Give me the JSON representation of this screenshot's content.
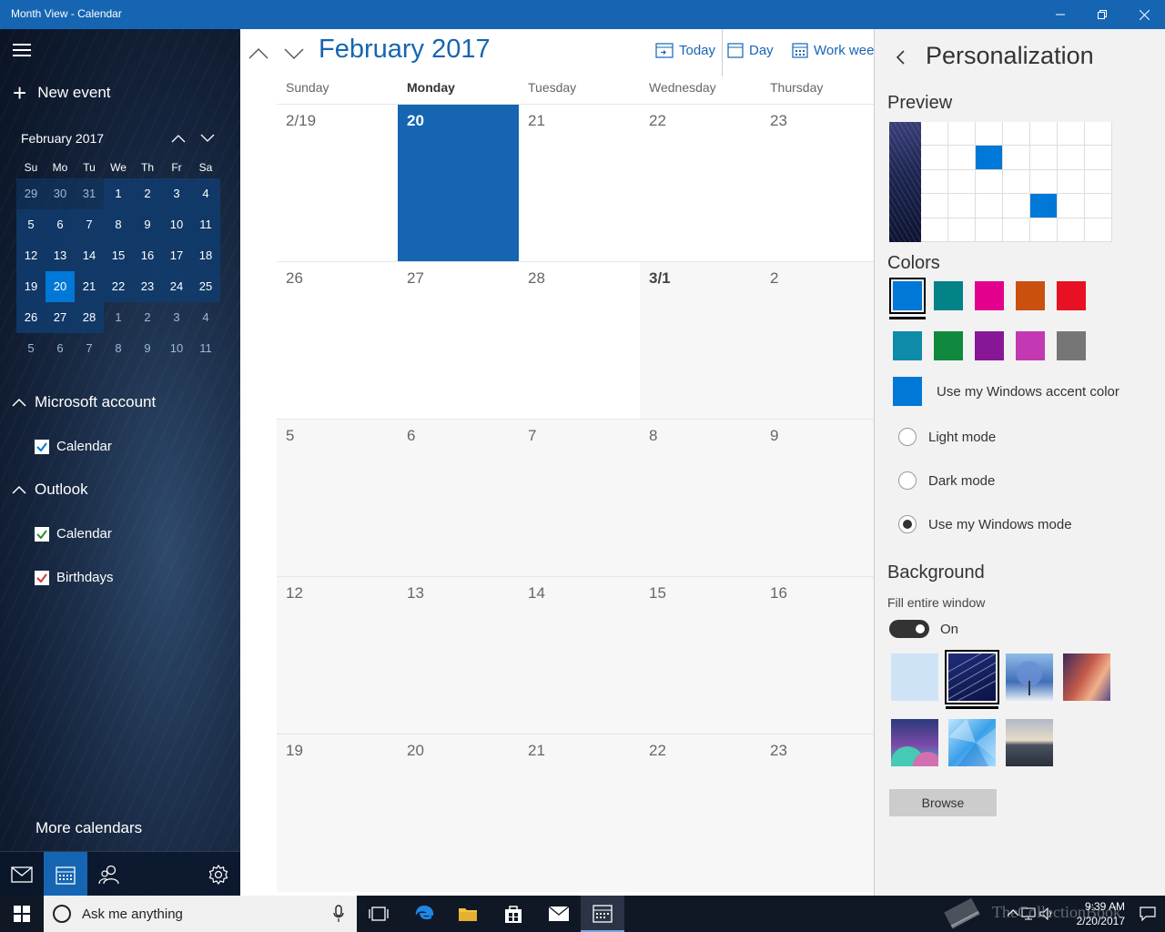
{
  "window": {
    "title": "Month View - Calendar"
  },
  "sidebar": {
    "new_event": "New event",
    "mini_calendar": {
      "title": "February 2017",
      "days_of_week": [
        "Su",
        "Mo",
        "Tu",
        "We",
        "Th",
        "Fr",
        "Sa"
      ],
      "weeks": [
        [
          "29",
          "30",
          "31",
          "1",
          "2",
          "3",
          "4"
        ],
        [
          "5",
          "6",
          "7",
          "8",
          "9",
          "10",
          "11"
        ],
        [
          "12",
          "13",
          "14",
          "15",
          "16",
          "17",
          "18"
        ],
        [
          "19",
          "20",
          "21",
          "22",
          "23",
          "24",
          "25"
        ],
        [
          "26",
          "27",
          "28",
          "1",
          "2",
          "3",
          "4"
        ],
        [
          "5",
          "6",
          "7",
          "8",
          "9",
          "10",
          "11"
        ]
      ],
      "selected_day": "20"
    },
    "accounts": [
      {
        "name": "Microsoft account",
        "calendars": [
          {
            "label": "Calendar",
            "checked": true,
            "color": "#0078d7"
          }
        ]
      },
      {
        "name": "Outlook",
        "calendars": [
          {
            "label": "Calendar",
            "checked": true,
            "color": "#2e8b3d"
          },
          {
            "label": "Birthdays",
            "checked": true,
            "color": "#d13438"
          }
        ]
      }
    ],
    "more_calendars": "More calendars"
  },
  "main": {
    "month_title": "February 2017",
    "toolbar": {
      "today": "Today",
      "day": "Day",
      "work_week": "Work week"
    },
    "days_of_week": [
      "Sunday",
      "Monday",
      "Tuesday",
      "Wednesday",
      "Thursday"
    ],
    "current_dow": "Monday",
    "weeks": [
      [
        "2/19",
        "20",
        "21",
        "22",
        "23"
      ],
      [
        "26",
        "27",
        "28",
        "3/1",
        "2"
      ],
      [
        "5",
        "6",
        "7",
        "8",
        "9"
      ],
      [
        "12",
        "13",
        "14",
        "15",
        "16"
      ],
      [
        "19",
        "20",
        "21",
        "22",
        "23"
      ]
    ]
  },
  "personalization": {
    "title": "Personalization",
    "preview_label": "Preview",
    "colors_label": "Colors",
    "colors": [
      "#0078d7",
      "#038387",
      "#e3008c",
      "#ca5010",
      "#e81123",
      "#0e8ba8",
      "#10893e",
      "#881798",
      "#c239b3",
      "#767676"
    ],
    "selected_color": "#0078d7",
    "accent_label": "Use my Windows accent color",
    "modes": [
      {
        "label": "Light mode",
        "selected": false
      },
      {
        "label": "Dark mode",
        "selected": false
      },
      {
        "label": "Use my Windows mode",
        "selected": true
      }
    ],
    "background_label": "Background",
    "fill_window_label": "Fill entire window",
    "toggle_state": "On",
    "browse_label": "Browse"
  },
  "taskbar": {
    "search_placeholder": "Ask me anything",
    "time": "9:39 AM",
    "date": "2/20/2017"
  },
  "watermark": "TheCollectionBook"
}
